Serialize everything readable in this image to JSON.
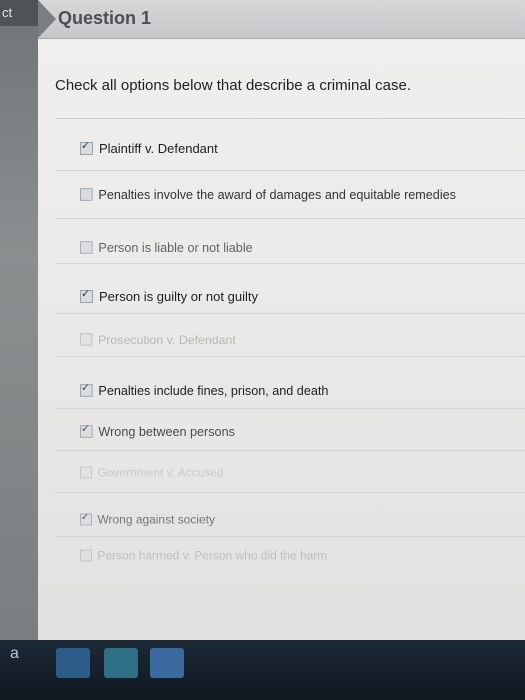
{
  "side_tab": "ct",
  "question": {
    "title": "Question 1",
    "prompt": "Check all options below that describe a criminal case."
  },
  "options": [
    {
      "label": "Plaintiff v. Defendant",
      "checked": true
    },
    {
      "label": "Penalties involve the award of damages and equitable remedies",
      "checked": false
    },
    {
      "label": "Person is liable or not liable",
      "checked": false
    },
    {
      "label": "Person is guilty or not guilty",
      "checked": true
    },
    {
      "label": "Prosecution v. Defendant",
      "checked": false
    },
    {
      "label": "Penalties include fines, prison, and death",
      "checked": true
    },
    {
      "label": "Wrong between persons",
      "checked": true
    },
    {
      "label": "Government v. Accused",
      "checked": false
    },
    {
      "label": "Wrong against society",
      "checked": true
    },
    {
      "label": "Person harmed v. Person who did the harm",
      "checked": false
    }
  ],
  "taskbar": {
    "letter": "a"
  },
  "colors": {
    "header": "#c9cacd",
    "content_bg": "#ecebea",
    "taskbar": "#16212c",
    "checkbox_check": "#1f3f66"
  }
}
